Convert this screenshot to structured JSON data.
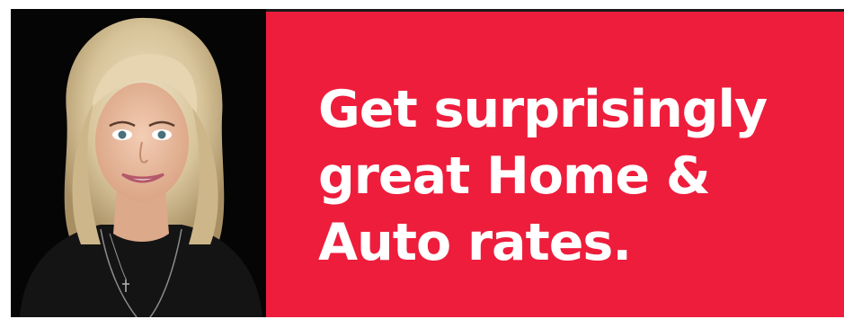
{
  "headline": {
    "line1": "Get surprisingly",
    "line2": "great Home &",
    "line3": "Auto rates."
  },
  "colors": {
    "accent": "#ee1d3c",
    "photo_background": "#050505",
    "text": "#ffffff"
  },
  "photo": {
    "subject": "portrait-photo"
  }
}
